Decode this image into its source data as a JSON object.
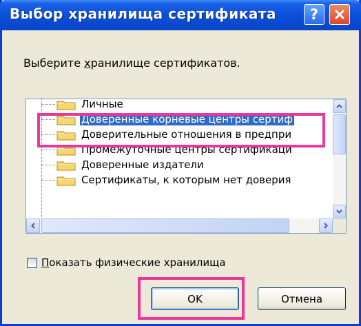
{
  "window": {
    "title": "Выбор хранилища сертификата",
    "help_symbol": "?",
    "close_symbol": "X"
  },
  "dialog": {
    "prompt_prefix": "Выберите ",
    "prompt_underlined": "х",
    "prompt_suffix": "ранилище сертификатов."
  },
  "list": {
    "items": [
      {
        "label": "Личные",
        "selected": false
      },
      {
        "label": "Доверенные корневые центры сертиф",
        "selected": true
      },
      {
        "label": "Доверительные отношения в предпри",
        "selected": false
      },
      {
        "label": "Промежуточные центры сертификаци",
        "selected": false
      },
      {
        "label": "Доверенные издатели",
        "selected": false
      },
      {
        "label": "Сертификаты, к которым нет доверия",
        "selected": false
      }
    ]
  },
  "options": {
    "show_physical_underlined": "П",
    "show_physical_rest": "оказать физические хранилища",
    "show_physical_checked": false
  },
  "buttons": {
    "ok": "OK",
    "cancel": "Отмена"
  },
  "colors": {
    "selection": "#316ac5",
    "highlight_frame": "#e8389a",
    "titlebar": "#0a4ed8"
  }
}
